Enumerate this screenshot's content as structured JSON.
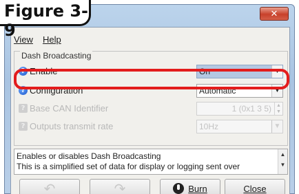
{
  "figure_label": "Figure 3-9",
  "window": {
    "close_glyph": "✕"
  },
  "menu": [
    {
      "label": "View"
    },
    {
      "label": "Help"
    }
  ],
  "group": {
    "title": "Dash Broadcasting",
    "rows": [
      {
        "label": "Enable",
        "value": "On",
        "icon": "help-icon",
        "disabled": false,
        "highlighted": true
      },
      {
        "label": "Configuration",
        "value": "Automatic",
        "icon": "help-icon",
        "disabled": false
      },
      {
        "label": "Base CAN Identifier",
        "value": "1 (0x1 3 5)",
        "icon": "help-icon-gray",
        "disabled": true
      },
      {
        "label": "Outputs transmit rate",
        "value": "10Hz",
        "icon": "help-icon-gray",
        "disabled": true
      }
    ]
  },
  "description": {
    "line1": "Enables or disables Dash Broadcasting",
    "line2": "This is a simplified set of data for display or logging sent over"
  },
  "buttons": {
    "undo_glyph": "↶",
    "redo_glyph": "↷",
    "burn_label": "Burn",
    "close_label": "Close"
  },
  "colors": {
    "highlight": "#e31c1c",
    "selected_value_bg": "#b4c8e2",
    "title_bar": "#a9c4e2"
  }
}
